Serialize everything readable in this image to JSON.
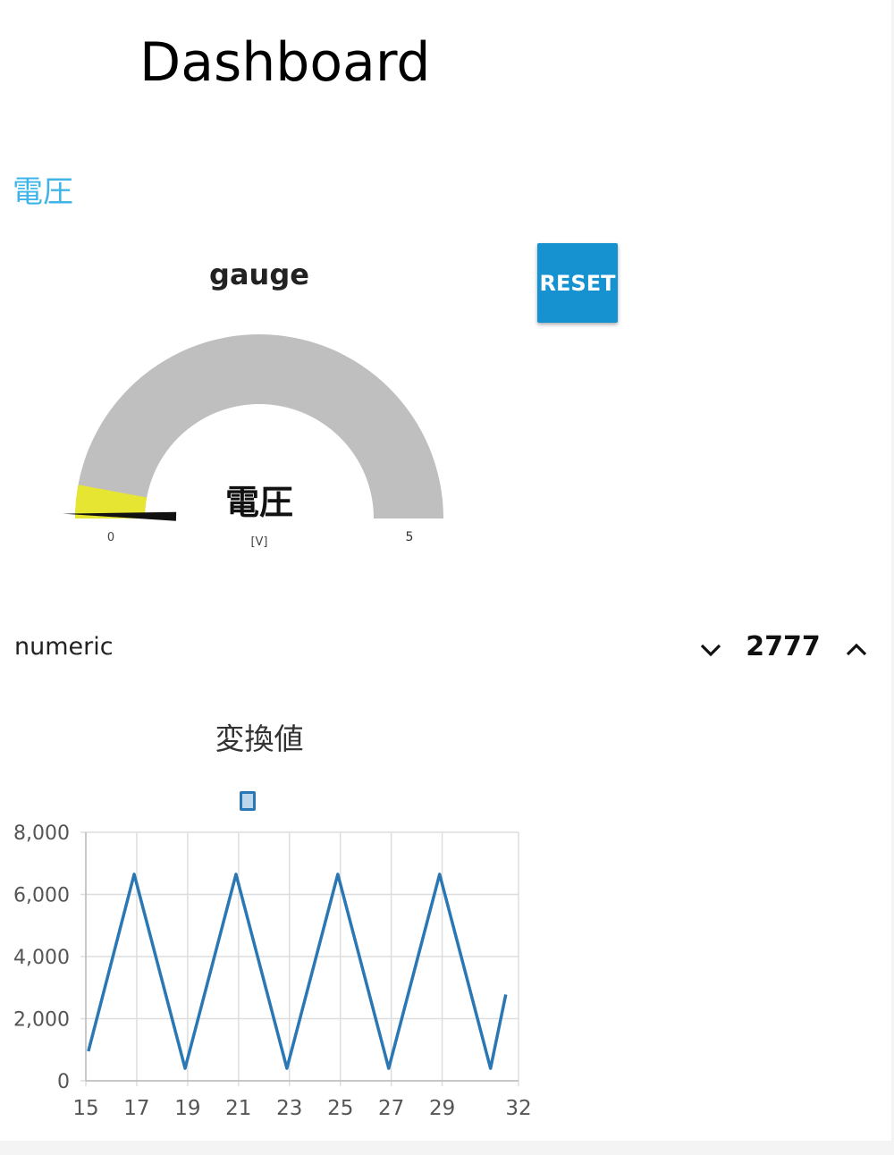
{
  "page": {
    "title": "Dashboard"
  },
  "group": {
    "title": "電圧"
  },
  "gauge": {
    "title": "gauge",
    "label": "電圧",
    "unit": "[V]",
    "min_label": "0",
    "max_label": "5",
    "value_fraction": 0.03,
    "track_color": "#bfbfbf",
    "fill_color": "#e6e632",
    "needle_color": "#111111"
  },
  "reset_button": {
    "label": "RESET",
    "color": "#1592cf"
  },
  "numeric": {
    "label": "numeric",
    "value": "2777",
    "down_icon": "chevron-down-icon",
    "up_icon": "chevron-up-icon"
  },
  "chart": {
    "title": "変換値",
    "legend_color": "#2a77b3"
  },
  "chart_data": {
    "type": "line",
    "title": "変換値",
    "xlabel": "",
    "ylabel": "",
    "xlim": [
      15,
      32
    ],
    "ylim": [
      0,
      8000
    ],
    "x_ticks": [
      "15",
      "17",
      "19",
      "21",
      "23",
      "25",
      "27",
      "29",
      "32"
    ],
    "x_tick_values": [
      15,
      17,
      19,
      21,
      23,
      25,
      27,
      29,
      32
    ],
    "y_ticks": [
      "0",
      "2,000",
      "4,000",
      "6,000",
      "8,000"
    ],
    "y_tick_values": [
      0,
      2000,
      4000,
      6000,
      8000
    ],
    "grid": true,
    "series": [
      {
        "color": "#2a77b3",
        "x": [
          15.1,
          16.9,
          18.9,
          20.9,
          22.9,
          24.9,
          26.9,
          28.9,
          30.9,
          31.5
        ],
        "y": [
          950,
          6650,
          400,
          6650,
          400,
          6650,
          400,
          6650,
          400,
          2777
        ]
      }
    ]
  }
}
